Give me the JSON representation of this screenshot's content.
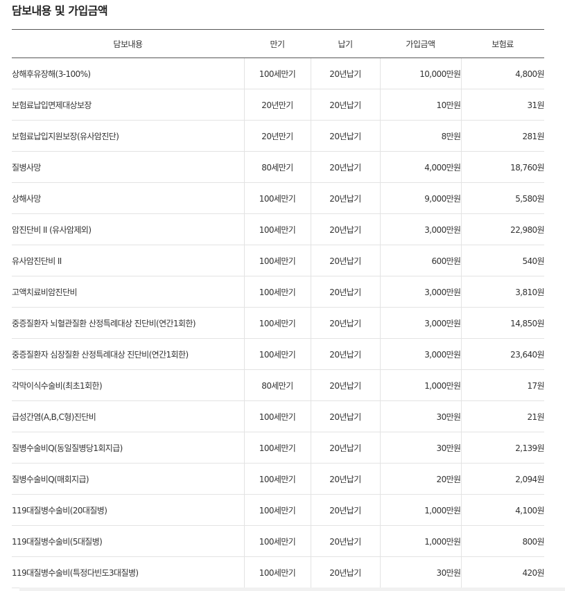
{
  "page": {
    "title": "담보내용 및 가입금액"
  },
  "table": {
    "headers": [
      "담보내용",
      "만기",
      "납기",
      "가입금액",
      "보험료"
    ],
    "rows": [
      [
        "상해후유장해(3-100%)",
        "100세만기",
        "20년납기",
        "10,000만원",
        "4,800원"
      ],
      [
        "보험료납입면제대상보장",
        "20년만기",
        "20년납기",
        "10만원",
        "31원"
      ],
      [
        "보험료납입지원보장(유사암진단)",
        "20년만기",
        "20년납기",
        "8만원",
        "281원"
      ],
      [
        "질병사망",
        "80세만기",
        "20년납기",
        "4,000만원",
        "18,760원"
      ],
      [
        "상해사망",
        "100세만기",
        "20년납기",
        "9,000만원",
        "5,580원"
      ],
      [
        "암진단비 II (유사암제외)",
        "100세만기",
        "20년납기",
        "3,000만원",
        "22,980원"
      ],
      [
        "유사암진단비 II",
        "100세만기",
        "20년납기",
        "600만원",
        "540원"
      ],
      [
        "고액치료비암진단비",
        "100세만기",
        "20년납기",
        "3,000만원",
        "3,810원"
      ],
      [
        "중증질환자 뇌혈관질환 산정특례대상 진단비(연간1회한)",
        "100세만기",
        "20년납기",
        "3,000만원",
        "14,850원"
      ],
      [
        "중증질환자 심장질환 산정특례대상 진단비(연간1회한)",
        "100세만기",
        "20년납기",
        "3,000만원",
        "23,640원"
      ],
      [
        "각막이식수술비(최초1회한)",
        "80세만기",
        "20년납기",
        "1,000만원",
        "17원"
      ],
      [
        "급성간염(A,B,C형)진단비",
        "100세만기",
        "20년납기",
        "30만원",
        "21원"
      ],
      [
        "질병수술비Q(동일질병당1회지급)",
        "100세만기",
        "20년납기",
        "30만원",
        "2,139원"
      ],
      [
        "질병수술비Q(매회지급)",
        "100세만기",
        "20년납기",
        "20만원",
        "2,094원"
      ],
      [
        "119대질병수술비(20대질병)",
        "100세만기",
        "20년납기",
        "1,000만원",
        "4,100원"
      ],
      [
        "119대질병수술비(5대질병)",
        "100세만기",
        "20년납기",
        "1,000만원",
        "800원"
      ],
      [
        "119대질병수술비(특정다빈도3대질병)",
        "100세만기",
        "20년납기",
        "30만원",
        "420원"
      ]
    ]
  }
}
